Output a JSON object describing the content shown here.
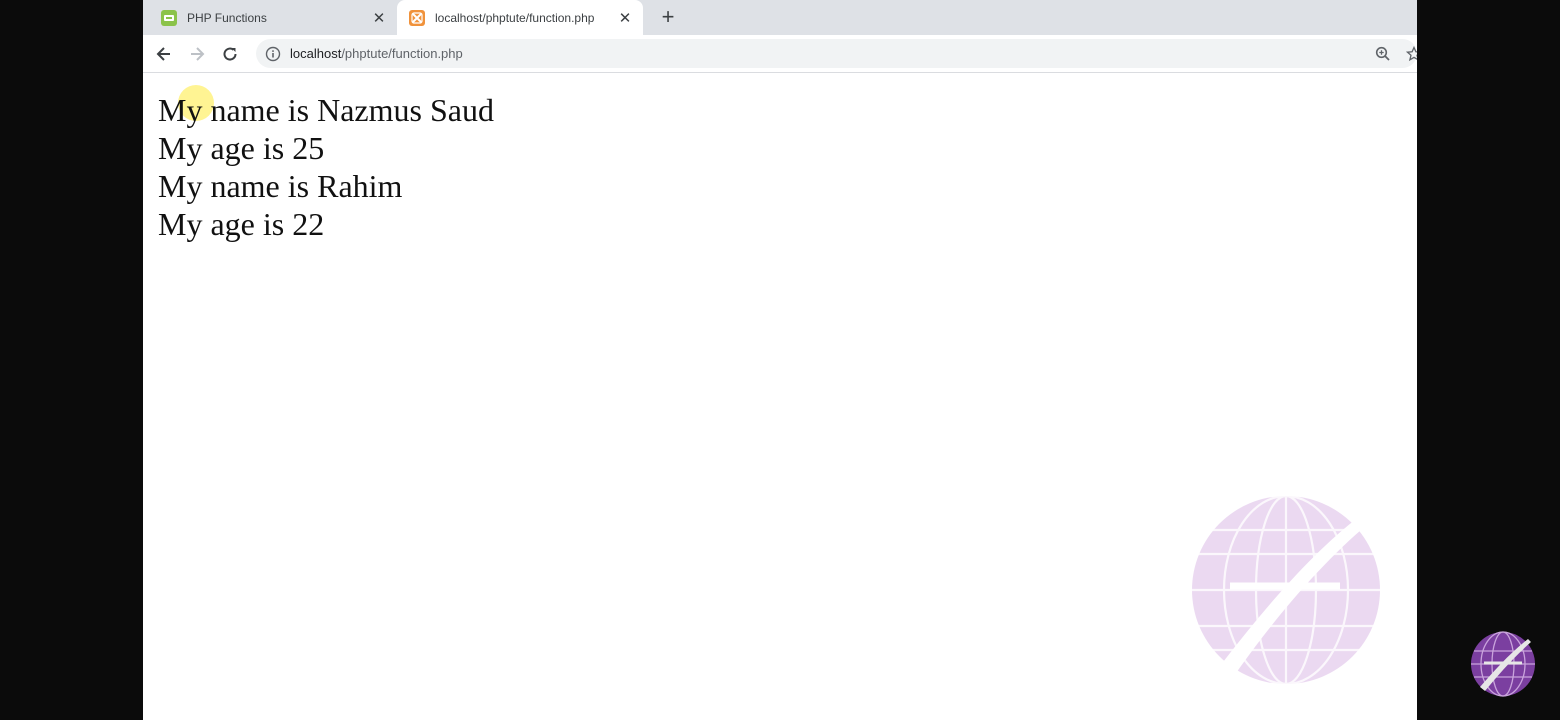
{
  "tabs": [
    {
      "title": "PHP Functions",
      "icon": "php-favicon-icon",
      "active": false
    },
    {
      "title": "localhost/phptute/function.php",
      "icon": "xampp-favicon-icon",
      "active": true
    }
  ],
  "new_tab_label": "+",
  "address_bar": {
    "host": "localhost",
    "path": "/phptute/function.php"
  },
  "page": {
    "lines": [
      "My name is Nazmus Saud",
      "My age is 25",
      "My name is Rahim",
      "My age is 22"
    ]
  },
  "colors": {
    "tab_strip": "#dee1e6",
    "omnibox": "#f1f3f4",
    "watermark": "#d8b4e2",
    "logo": "#7b3fa0"
  }
}
